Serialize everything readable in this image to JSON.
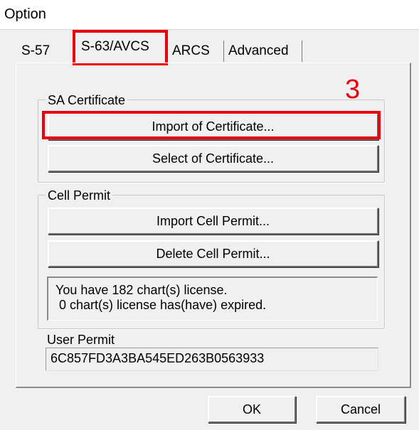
{
  "window": {
    "title": "Option"
  },
  "tabs": [
    {
      "label": "S-57",
      "selected": false
    },
    {
      "label": "S-63/AVCS",
      "selected": true
    },
    {
      "label": "ARCS",
      "selected": false
    },
    {
      "label": "Advanced",
      "selected": false
    }
  ],
  "annotation": {
    "step_number": "3",
    "color": "#e8000d"
  },
  "sa_certificate": {
    "legend": "SA Certificate",
    "import_label": "Import of Certificate...",
    "select_label": "Select of Certificate..."
  },
  "cell_permit": {
    "legend": "Cell Permit",
    "import_label": "Import Cell Permit...",
    "delete_label": "Delete Cell Permit...",
    "info_lines": [
      "You have 182 chart(s) license.",
      " 0 chart(s) license has(have) expired."
    ]
  },
  "user_permit": {
    "label": "User Permit",
    "value": "6C857FD3A3BA545ED263B0563933"
  },
  "footer": {
    "ok_label": "OK",
    "cancel_label": "Cancel"
  }
}
